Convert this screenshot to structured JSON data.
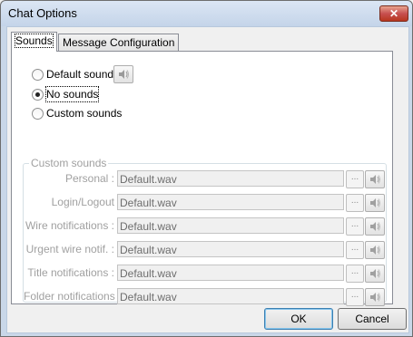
{
  "window": {
    "title": "Chat Options",
    "close_glyph": "✕"
  },
  "tabs": [
    {
      "label": "Sounds",
      "active": true
    },
    {
      "label": "Message Configuration",
      "active": false
    }
  ],
  "sound_mode": {
    "options": [
      {
        "label": "Default sound",
        "checked": false
      },
      {
        "label": "No sounds",
        "checked": true
      },
      {
        "label": "Custom sounds",
        "checked": false
      }
    ]
  },
  "custom_sounds": {
    "title": "Custom sounds",
    "browse_label": "...",
    "rows": [
      {
        "label": "Personal :",
        "file": "Default.wav"
      },
      {
        "label": "Login/Logout",
        "file": "Default.wav"
      },
      {
        "label": "Wire notifications :",
        "file": "Default.wav"
      },
      {
        "label": "Urgent wire notif. :",
        "file": "Default.wav"
      },
      {
        "label": "Title notifications :",
        "file": "Default.wav"
      },
      {
        "label": "Folder notifications :",
        "file": "Default.wav"
      }
    ]
  },
  "buttons": {
    "ok": "OK",
    "cancel": "Cancel"
  },
  "icons": {
    "speaker": "speaker-icon",
    "close": "close-icon",
    "browse": "browse-icon"
  }
}
